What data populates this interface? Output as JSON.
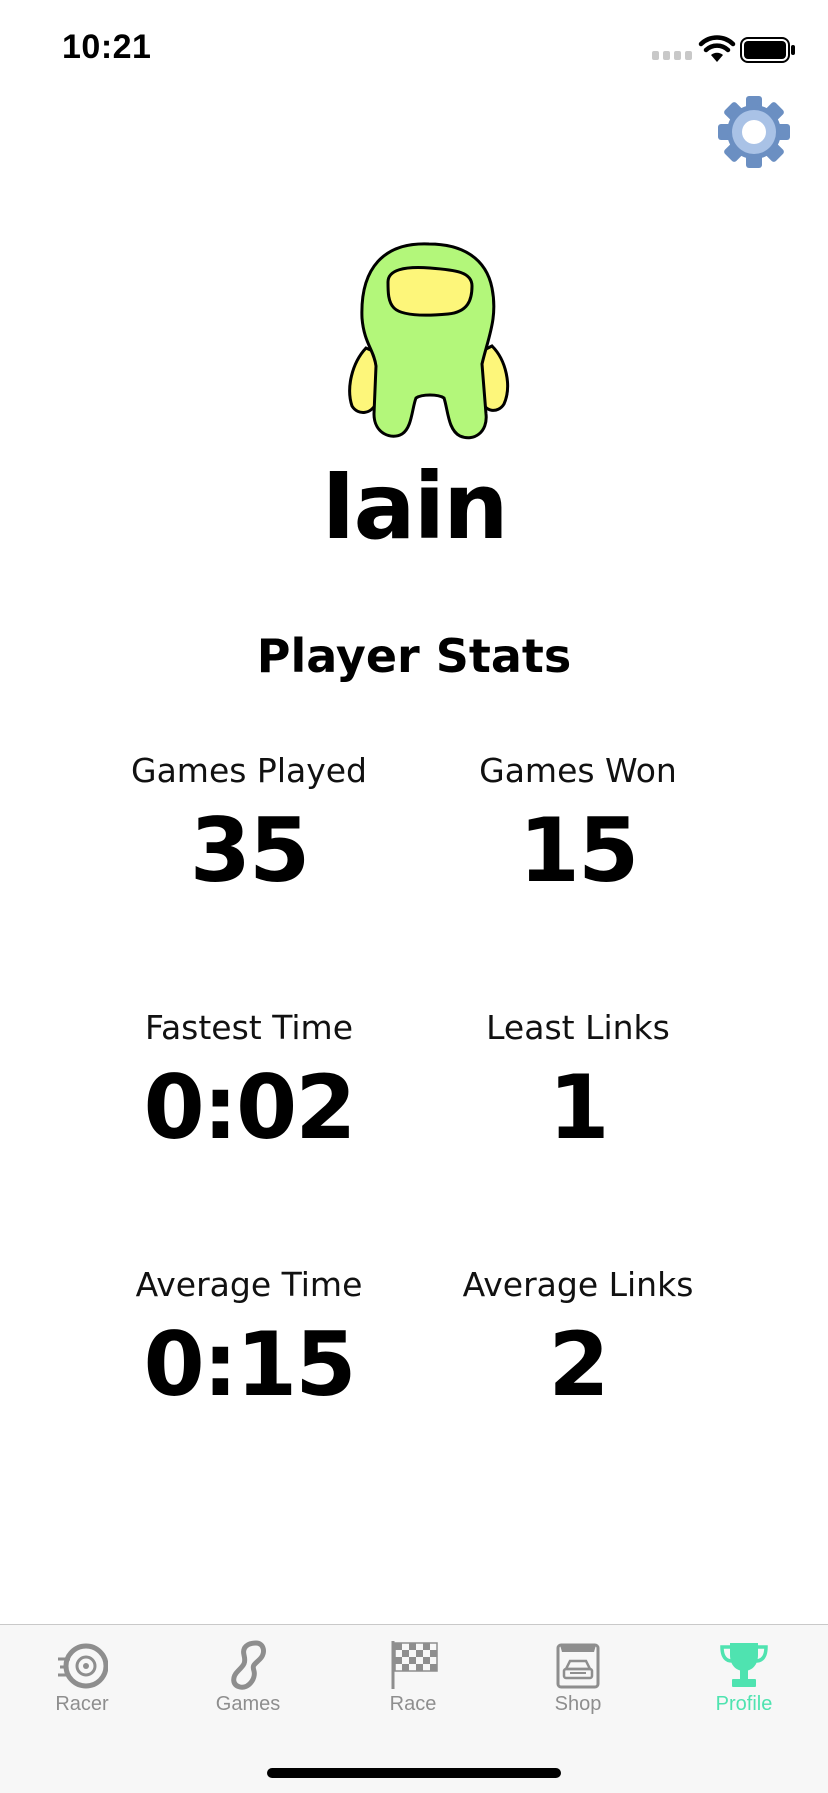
{
  "status_bar": {
    "time": "10:21"
  },
  "profile": {
    "username": "Iain",
    "stats_title": "Player Stats"
  },
  "stats": [
    {
      "label": "Games Played",
      "value": "35"
    },
    {
      "label": "Games Won",
      "value": "15"
    },
    {
      "label": "Fastest Time",
      "value": "0:02"
    },
    {
      "label": "Least Links",
      "value": "1"
    },
    {
      "label": "Average Time",
      "value": "0:15"
    },
    {
      "label": "Average Links",
      "value": "2"
    }
  ],
  "tab_bar": {
    "items": [
      {
        "label": "Racer",
        "icon": "tire-icon"
      },
      {
        "label": "Games",
        "icon": "track-icon"
      },
      {
        "label": "Race",
        "icon": "checkered-flag-icon"
      },
      {
        "label": "Shop",
        "icon": "shop-car-icon"
      },
      {
        "label": "Profile",
        "icon": "trophy-icon"
      }
    ],
    "active": "Profile"
  },
  "colors": {
    "accent": "#4fe3b0",
    "inactive_tab": "#8e8e8e",
    "gear": "#6b8fc2",
    "avatar_body": "#b3f77a",
    "avatar_visor": "#fdf67a"
  }
}
